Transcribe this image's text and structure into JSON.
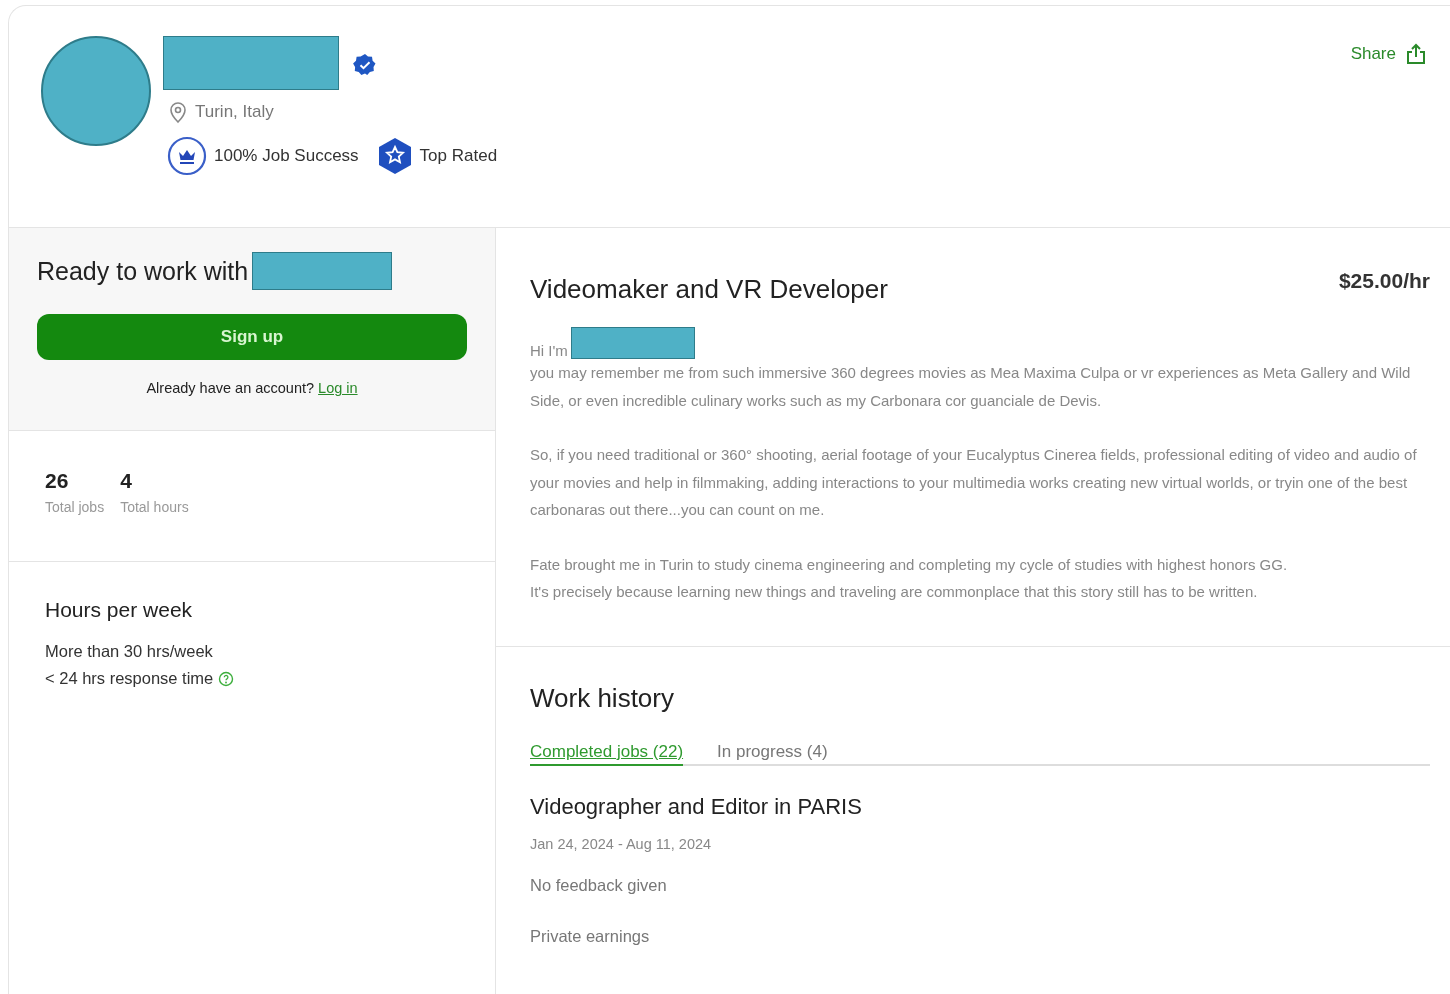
{
  "profile": {
    "location": "Turin, Italy",
    "verified": true,
    "badges": [
      {
        "kind": "job-success",
        "label": "100% Job Success"
      },
      {
        "kind": "top-rated",
        "label": "Top Rated"
      }
    ],
    "share": "Share"
  },
  "signup_card": {
    "title": "Ready to work with",
    "button": "Sign up",
    "account_prompt": "Already have an account?",
    "login_link": "Log in"
  },
  "stats": [
    {
      "value": "26",
      "label": "Total jobs"
    },
    {
      "value": "4",
      "label": "Total hours"
    }
  ],
  "availability": {
    "title": "Hours per week",
    "hours": "More than 30 hrs/week",
    "response": "< 24 hrs response time"
  },
  "overview": {
    "title": "Videomaker and VR Developer",
    "rate": "$25.00/hr",
    "greeting": "Hi I'm",
    "paragraphs": [
      [
        "you may remember me from such immersive 360 degrees movies as Mea Maxima Culpa or vr experiences as Meta Gallery and Wild Side, or even incredible culinary works such as my Carbonara cor guanciale de Devis."
      ],
      [
        "So, if you need traditional or 360° shooting, aerial footage of your Eucalyptus Cinerea fields, professional editing of video and audio of your movies and help in filmmaking, adding interactions to your multimedia works creating new virtual worlds, or tryin one of the best carbonaras out there...you can count on me."
      ],
      [
        "Fate brought me in Turin to study cinema engineering and completing my cycle of studies with highest honors GG.",
        "It's precisely because learning new things and traveling are commonplace that this story still has to be written."
      ]
    ]
  },
  "work_history": {
    "title": "Work history",
    "tabs": [
      {
        "label": "Completed jobs (22)",
        "selected": true
      },
      {
        "label": "In progress (4)",
        "selected": false
      }
    ],
    "job": {
      "title": "Videographer and Editor in PARIS",
      "dates": "Jan 24, 2024 - Aug 11, 2024",
      "feedback": "No feedback given",
      "earnings": "Private earnings"
    }
  }
}
